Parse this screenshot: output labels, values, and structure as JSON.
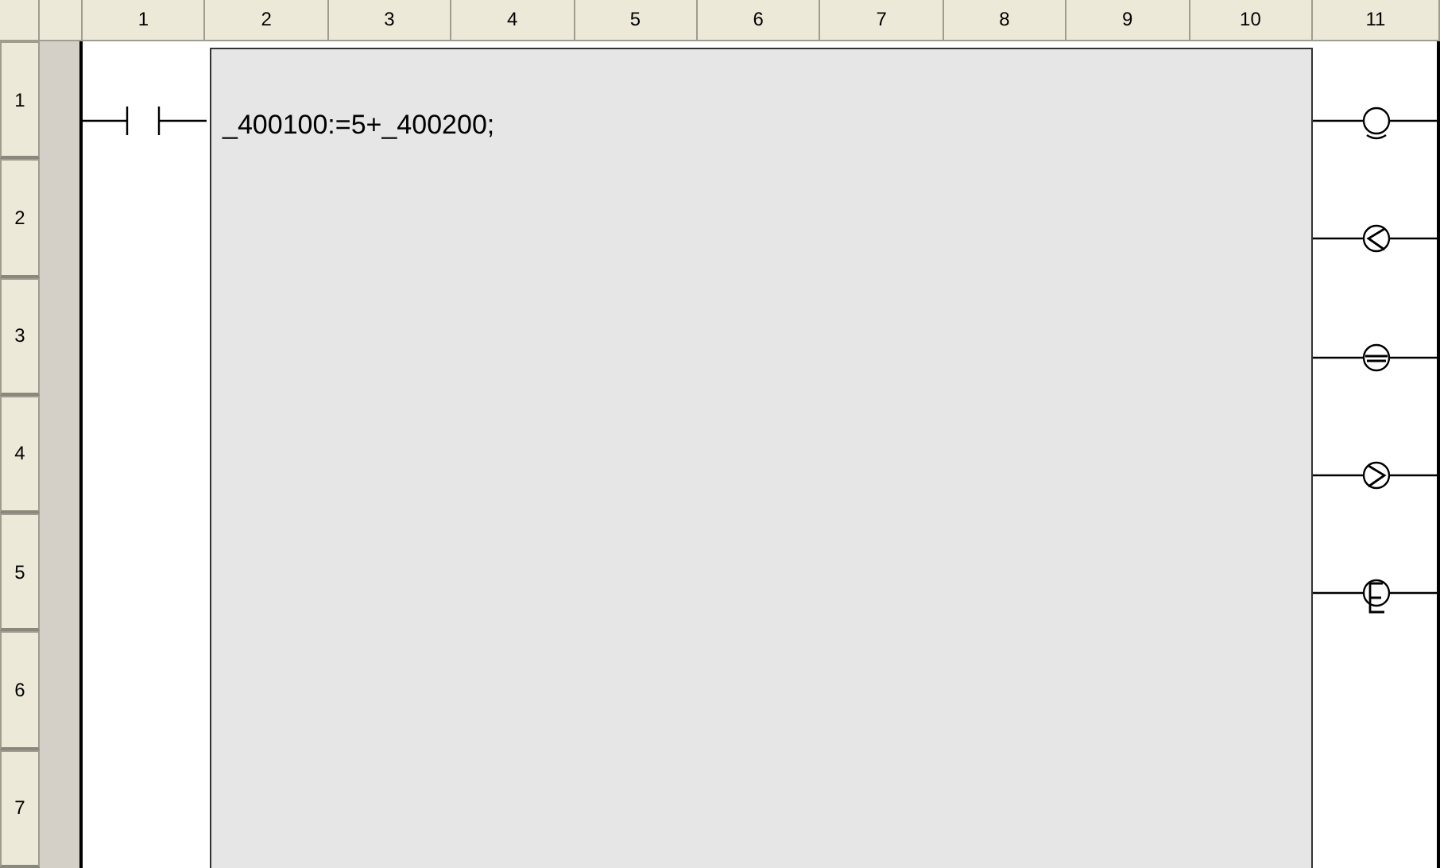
{
  "column_headers": [
    "1",
    "2",
    "3",
    "4",
    "5",
    "6",
    "7",
    "8",
    "9",
    "10",
    "11"
  ],
  "row_headers": [
    "1",
    "2",
    "3",
    "4",
    "5",
    "6",
    "7"
  ],
  "function_block": {
    "text": "_400100:=5+_400200;"
  },
  "contacts": [
    {
      "kind": "normally_open"
    }
  ],
  "coils": [
    {
      "kind": "arc"
    },
    {
      "kind": "less"
    },
    {
      "kind": "bar"
    },
    {
      "kind": "greater"
    },
    {
      "kind": "letter"
    }
  ]
}
